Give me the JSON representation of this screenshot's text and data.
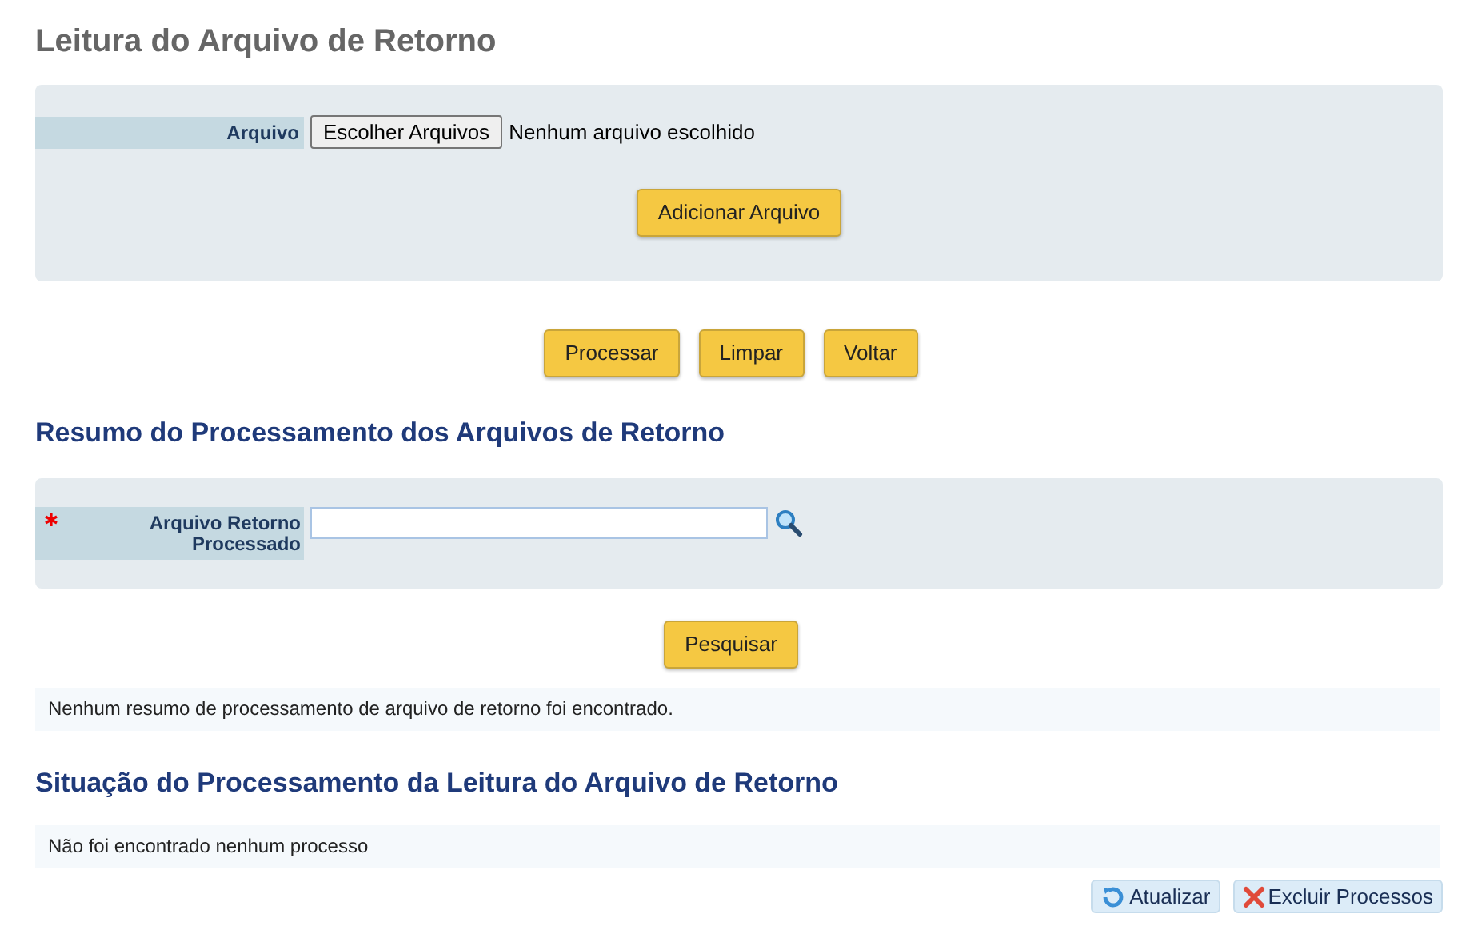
{
  "title": "Leitura do Arquivo de Retorno",
  "upload_panel": {
    "label": "Arquivo",
    "file_button": "Escolher Arquivos",
    "file_status": "Nenhum arquivo escolhido",
    "add_button": "Adicionar Arquivo"
  },
  "actions": [
    "Processar",
    "Limpar",
    "Voltar"
  ],
  "summary": {
    "heading": "Resumo do Processamento dos Arquivos de Retorno",
    "field": {
      "label": "Arquivo Retorno Processado",
      "required": true
    },
    "search_button": "Pesquisar",
    "message": "Nenhum resumo de processamento de arquivo de retorno foi encontrado."
  },
  "status": {
    "heading": "Situação do Processamento da Leitura do Arquivo de Retorno",
    "message": "Não foi encontrado nenhum processo",
    "buttons": [
      {
        "kind": "refresh",
        "label": "Atualizar"
      },
      {
        "kind": "delete",
        "label": "Excluir Processos"
      }
    ]
  }
}
